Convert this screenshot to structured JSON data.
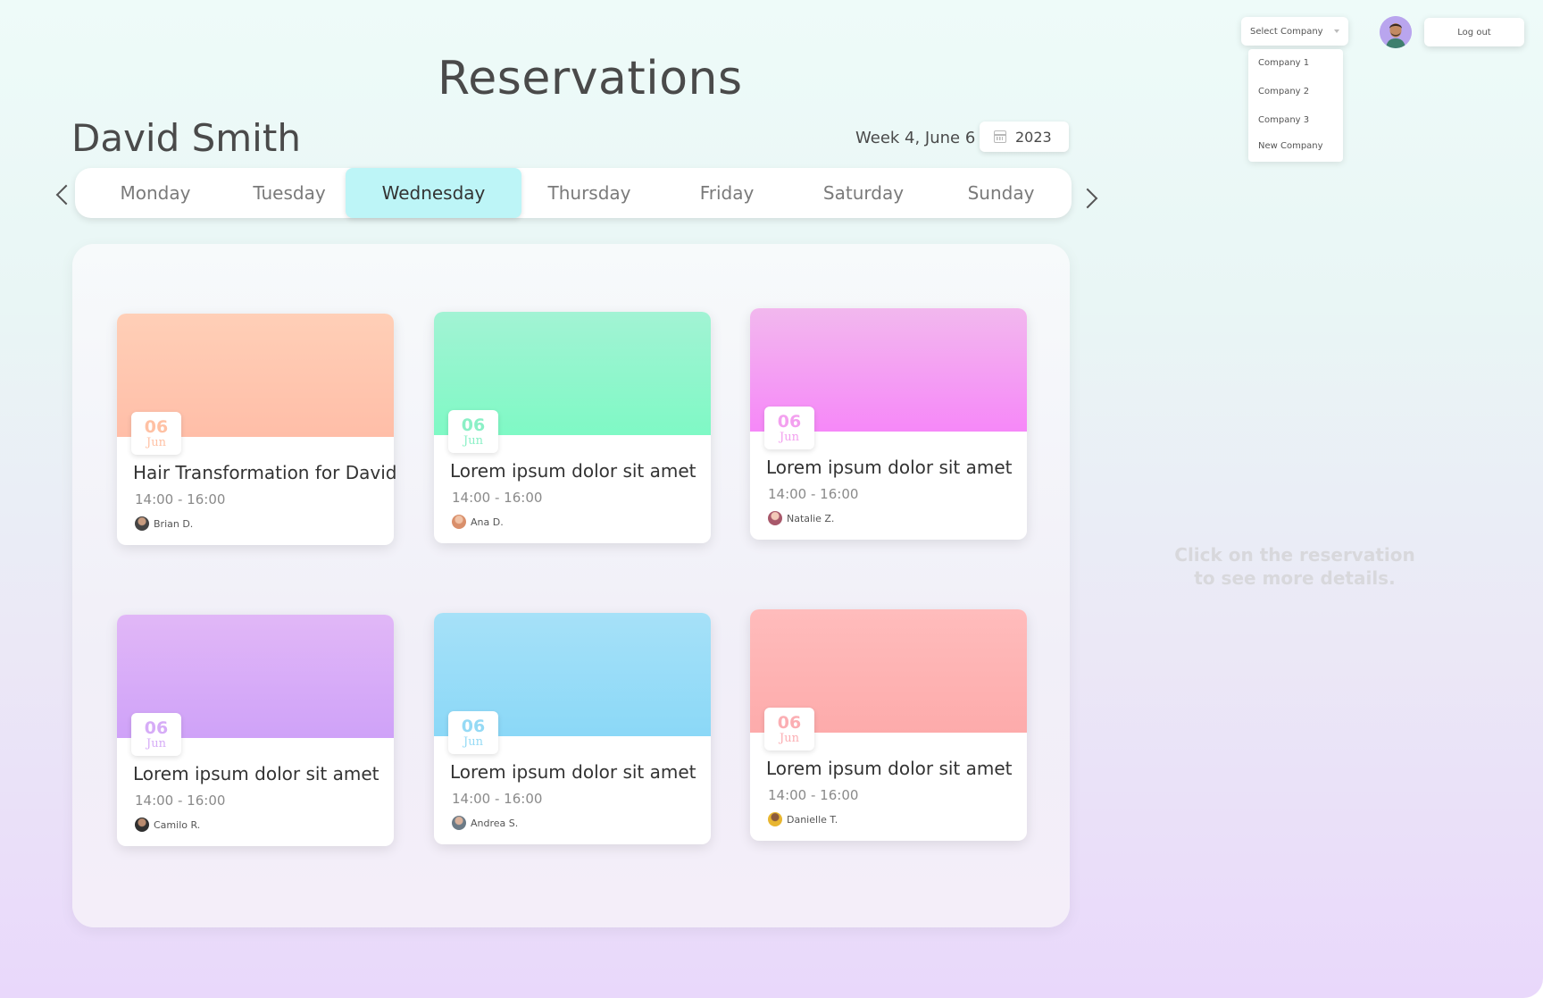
{
  "page": {
    "title": "Reservations",
    "user_name": "David Smith"
  },
  "week": {
    "label": "Week 4, June 6",
    "year": "2023"
  },
  "days": [
    "Monday",
    "Tuesday",
    "Wednesday",
    "Thursday",
    "Friday",
    "Saturday",
    "Sunday"
  ],
  "active_day": "Wednesday",
  "reservations": [
    {
      "day": "06",
      "month": "Jun",
      "title": "Hair Transformation for David",
      "time": "14:00 - 16:00",
      "person": "Brian D.",
      "color_top": "#ffcfb7",
      "color_bottom": "#ffbea8",
      "accent": "#ffc1a4"
    },
    {
      "day": "06",
      "month": "Jun",
      "title": "Lorem ipsum dolor sit amet",
      "time": "14:00 - 16:00",
      "person": "Ana D.",
      "color_top": "#a2f3d4",
      "color_bottom": "#7ff9c5",
      "accent": "#8bf0c6"
    },
    {
      "day": "06",
      "month": "Jun",
      "title": "Lorem ipsum dolor sit amet",
      "time": "14:00 - 16:00",
      "person": "Natalie Z.",
      "color_top": "#f2b8ee",
      "color_bottom": "#f688f8",
      "accent": "#f3a0ef"
    },
    {
      "day": "06",
      "month": "Jun",
      "title": "Lorem ipsum dolor sit amet",
      "time": "14:00 - 16:00",
      "person": "Camilo R.",
      "color_top": "#e1b7f7",
      "color_bottom": "#cfa2f8",
      "accent": "#d6acf7"
    },
    {
      "day": "06",
      "month": "Jun",
      "title": "Lorem ipsum dolor sit amet",
      "time": "14:00 - 16:00",
      "person": "Andrea S.",
      "color_top": "#a6e1f8",
      "color_bottom": "#8bd8f7",
      "accent": "#95daf5"
    },
    {
      "day": "06",
      "month": "Jun",
      "title": "Lorem ipsum dolor sit amet",
      "time": "14:00 - 16:00",
      "person": "Danielle T.",
      "color_top": "#ffbcbc",
      "color_bottom": "#fdabab",
      "accent": "#fbaeb3"
    }
  ],
  "side_hint": "Click on the reservation to see more details.",
  "company_select": {
    "label": "Select Company",
    "options": [
      "Company 1",
      "Company 2",
      "Company 3",
      "New Company"
    ]
  },
  "logout_label": "Log out"
}
